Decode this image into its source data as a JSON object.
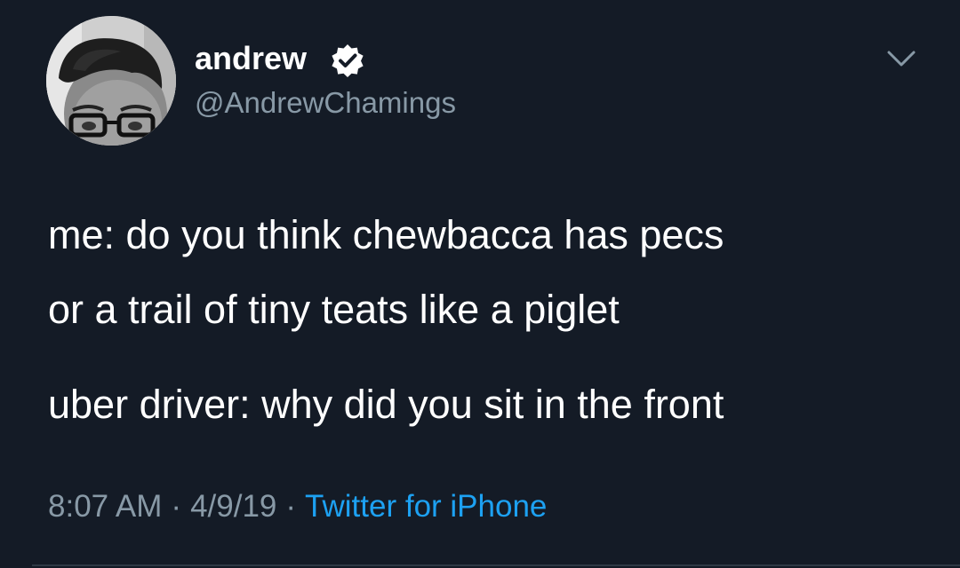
{
  "tweet": {
    "author": {
      "display_name": "andrew",
      "handle": "@AndrewChamings",
      "verified": true,
      "avatar_icon": "profile-photo",
      "verified_icon": "verified-badge-icon"
    },
    "menu_icon": "chevron-down-icon",
    "text_lines": [
      "me: do you think chewbacca has pecs",
      "or a trail of tiny teats like a piglet",
      "uber driver: why did you sit in the front"
    ],
    "meta": {
      "time": "8:07 AM",
      "separator": "·",
      "date": "4/9/19",
      "source": "Twitter for iPhone"
    }
  },
  "colors": {
    "background": "#141b26",
    "primary_text": "#ffffff",
    "secondary_text": "#8899a6",
    "link": "#1da1f2",
    "divider": "#2f3945"
  }
}
